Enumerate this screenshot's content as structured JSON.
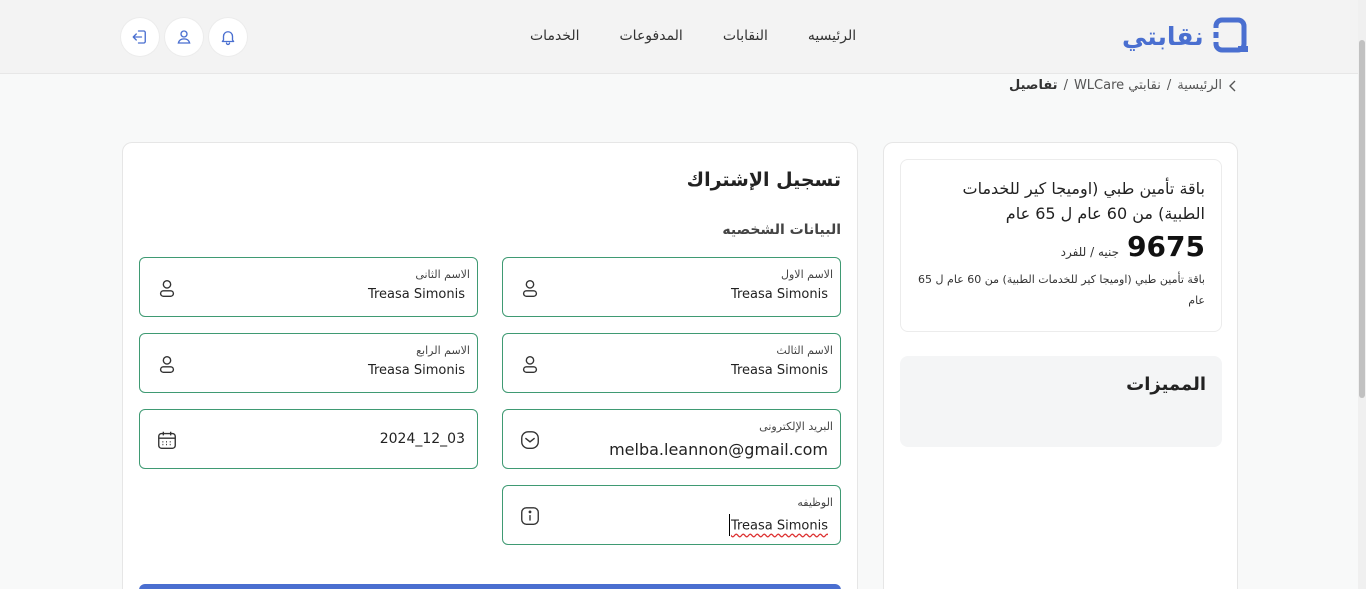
{
  "brand": {
    "name": "نقابتي"
  },
  "nav": [
    "الرئيسيه",
    "النقابات",
    "المدفوعات",
    "الخدمات"
  ],
  "header_icons": [
    "bell-icon",
    "user-icon",
    "logout-icon"
  ],
  "breadcrumb": {
    "home": "الرئيسية",
    "section": "نقابتي WLCare",
    "current": "تفاصيل",
    "sep": "/"
  },
  "package": {
    "title": "باقة تأمين طبي (اوميجا كير للخدمات الطبية) من 60 عام ل 65 عام",
    "price": "9675",
    "price_unit": "جنيه / للفرد",
    "description": "باقة تأمين طبي (اوميجا كير للخدمات الطبية) من 60 عام ل 65 عام"
  },
  "features": {
    "title": "المميزات"
  },
  "form": {
    "title": "تسجيل الإشتراك",
    "section": "البيانات الشخصيه",
    "fields": {
      "first_name": {
        "label": "الاسم الاول",
        "value": "Treasa Simonis"
      },
      "second_name": {
        "label": "الاسم الثانى",
        "value": "Treasa Simonis"
      },
      "third_name": {
        "label": "الاسم الثالث",
        "value": "Treasa Simonis"
      },
      "fourth_name": {
        "label": "الاسم الرابع",
        "value": "Treasa Simonis"
      },
      "email": {
        "label": "البريد الإلكترونى",
        "value": "melba.leannon@gmail.com"
      },
      "date": {
        "value": "2024_12_03"
      },
      "job": {
        "label": "الوظيفه",
        "value": "Treasa Simonis"
      }
    }
  },
  "colors": {
    "accent": "#4a6fd0",
    "field_border": "#3f9a73"
  }
}
